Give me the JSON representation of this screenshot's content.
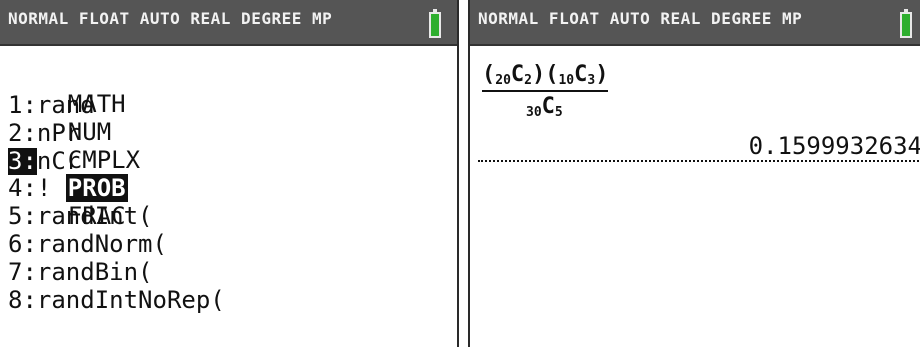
{
  "left_screen": {
    "status_text": "NORMAL FLOAT AUTO REAL DEGREE MP",
    "battery_icon": "battery-icon",
    "tabs": [
      {
        "label": "MATH",
        "selected": false
      },
      {
        "label": "NUM",
        "selected": false
      },
      {
        "label": "CMPLX",
        "selected": false
      },
      {
        "label": "PROB",
        "selected": true
      },
      {
        "label": "FRAC",
        "selected": false
      }
    ],
    "items": [
      {
        "num": "1:",
        "label": "rand"
      },
      {
        "num": "2:",
        "label": "nPr"
      },
      {
        "num": "3:",
        "label": "nCr",
        "selected": true
      },
      {
        "num": "4:",
        "label": "!"
      },
      {
        "num": "5:",
        "label": "randInt("
      },
      {
        "num": "6:",
        "label": "randNorm("
      },
      {
        "num": "7:",
        "label": "randBin("
      },
      {
        "num": "8:",
        "label": "randIntNoRep("
      }
    ]
  },
  "right_screen": {
    "status_text": "NORMAL FLOAT AUTO REAL DEGREE MP",
    "battery_icon": "battery-icon",
    "expression": {
      "term1_n": "20",
      "term1_r": "2",
      "term2_n": "10",
      "term2_r": "3",
      "denom_n": "30",
      "denom_r": "5",
      "symbol": "C"
    },
    "result": "0.1599932634"
  },
  "colors": {
    "status_bg": "#555555",
    "battery_green": "#2eae2e",
    "highlight": "#111111"
  }
}
